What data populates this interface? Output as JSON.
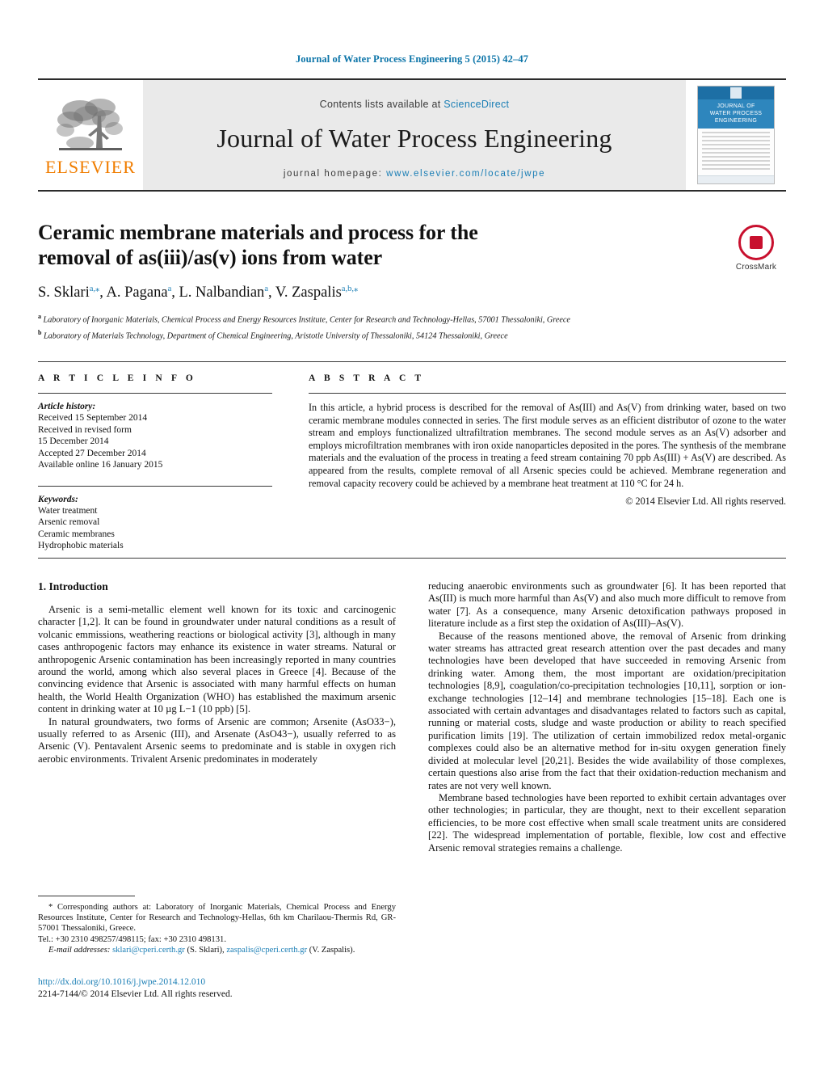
{
  "running_head": "Journal of Water Process Engineering 5 (2015) 42–47",
  "masthead": {
    "publisher_name": "ELSEVIER",
    "contents_prefix": "Contents lists available at ",
    "contents_link": "ScienceDirect",
    "journal_title": "Journal of Water Process Engineering",
    "homepage_prefix": "journal homepage: ",
    "homepage_url": "www.elsevier.com/locate/jwpe",
    "cover": {
      "line1": "JOURNAL OF",
      "line2": "WATER PROCESS",
      "line3": "ENGINEERING"
    }
  },
  "article": {
    "title": "Ceramic membrane materials and process for the removal of as(iii)/as(v) ions from water",
    "authors": [
      {
        "name": "S. Sklari",
        "marks": "a,⁎"
      },
      {
        "name": "A. Pagana",
        "marks": "a"
      },
      {
        "name": "L. Nalbandian",
        "marks": "a"
      },
      {
        "name": "V. Zaspalis",
        "marks": "a,b,⁎"
      }
    ],
    "affiliations": [
      {
        "mark": "a",
        "text": "Laboratory of Inorganic Materials, Chemical Process and Energy Resources Institute, Center for Research and Technology-Hellas, 57001 Thessaloniki, Greece"
      },
      {
        "mark": "b",
        "text": "Laboratory of Materials Technology, Department of Chemical Engineering, Aristotle University of Thessaloniki, 54124 Thessaloniki, Greece"
      }
    ],
    "crossmark_label": "CrossMark"
  },
  "info": {
    "heading": "A R T I C L E   I N F O",
    "history_label": "Article history:",
    "history": [
      "Received 15 September 2014",
      "Received in revised form",
      "15 December 2014",
      "Accepted 27 December 2014",
      "Available online 16 January 2015"
    ],
    "keywords_label": "Keywords:",
    "keywords": [
      "Water treatment",
      "Arsenic removal",
      "Ceramic membranes",
      "Hydrophobic materials"
    ]
  },
  "abstract": {
    "heading": "A B S T R A C T",
    "text": "In this article, a hybrid process is described for the removal of As(III) and As(V) from drinking water, based on two ceramic membrane modules connected in series. The first module serves as an efficient distributor of ozone to the water stream and employs functionalized ultrafiltration membranes. The second module serves as an As(V) adsorber and employs microfiltration membranes with iron oxide nanoparticles deposited in the pores. The synthesis of the membrane materials and the evaluation of the process in treating a feed stream containing 70 ppb As(III) + As(V) are described. As appeared from the results, complete removal of all Arsenic species could be achieved. Membrane regeneration and removal capacity recovery could be achieved by a membrane heat treatment at 110 °C for 24 h.",
    "copyright": "© 2014 Elsevier Ltd. All rights reserved."
  },
  "body": {
    "section_heading": "1.  Introduction",
    "left_paragraphs": [
      "Arsenic is a semi-metallic element well known for its toxic and carcinogenic character [1,2]. It can be found in groundwater under natural conditions as a result of volcanic emmissions, weathering reactions or biological activity [3], although in many cases anthropogenic factors may enhance its existence in water streams. Natural or anthropogenic Arsenic contamination has been increasingly reported in many countries around the world, among which also several places in Greece [4]. Because of the convincing evidence that Arsenic is associated with many harmful effects on human health, the World Health Organization (WHO) has established the maximum arsenic content in drinking water at 10 µg L−1 (10 ppb) [5].",
      "In natural groundwaters, two forms of Arsenic are common; Arsenite (AsO33−), usually referred to as Arsenic (III), and Arsenate (AsO43−), usually referred to as Arsenic (V). Pentavalent Arsenic seems to predominate and is stable in oxygen rich aerobic environments. Trivalent Arsenic predominates in moderately"
    ],
    "right_paragraphs": [
      "reducing anaerobic environments such as groundwater [6]. It has been reported that As(III) is much more harmful than As(V) and also much more difficult to remove from water [7]. As a consequence, many Arsenic detoxification pathways proposed in literature include as a first step the oxidation of As(III)–As(V).",
      "Because of the reasons mentioned above, the removal of Arsenic from drinking water streams has attracted great research attention over the past decades and many technologies have been developed that have succeeded in removing Arsenic from drinking water. Among them, the most important are oxidation/precipitation technologies [8,9], coagulation/co-precipitation technologies [10,11], sorption or ion-exchange technologies [12–14] and membrane technologies [15–18]. Each one is associated with certain advantages and disadvantages related to factors such as capital, running or material costs, sludge and waste production or ability to reach specified purification limits [19]. The utilization of certain immobilized redox metal-organic complexes could also be an alternative method for in-situ oxygen generation finely divided at molecular level [20,21]. Besides the wide availability of those complexes, certain questions also arise from the fact that their oxidation-reduction mechanism and rates are not very well known.",
      "Membrane based technologies have been reported to exhibit certain advantages over other technologies; in particular, they are thought, next to their excellent separation efficiencies, to be more cost effective when small scale treatment units are considered [22]. The widespread implementation of portable, flexible, low cost and effective Arsenic removal strategies remains a challenge."
    ]
  },
  "footnote": {
    "corresponding": "* Corresponding authors at: Laboratory of Inorganic Materials, Chemical Process and Energy Resources Institute, Center for Research and Technology-Hellas, 6th km Charilaou-Thermis Rd, GR-57001 Thessaloniki, Greece.",
    "tel": "Tel.: +30 2310 498257/498115; fax: +30 2310 498131.",
    "email_label": "E-mail addresses:",
    "email1": "sklari@cperi.certh.gr",
    "email1_owner": "(S. Sklari),",
    "email2": "zaspalis@cperi.certh.gr",
    "email2_owner": "(V. Zaspalis)."
  },
  "bottom": {
    "doi": "http://dx.doi.org/10.1016/j.jwpe.2014.12.010",
    "issn_line": "2214-7144/© 2014 Elsevier Ltd. All rights reserved."
  },
  "colors": {
    "link_blue": "#1a7eb5",
    "elsevier_orange": "#f07d00",
    "crossmark_red": "#c8102e",
    "masthead_gray": "#eaeaea"
  }
}
